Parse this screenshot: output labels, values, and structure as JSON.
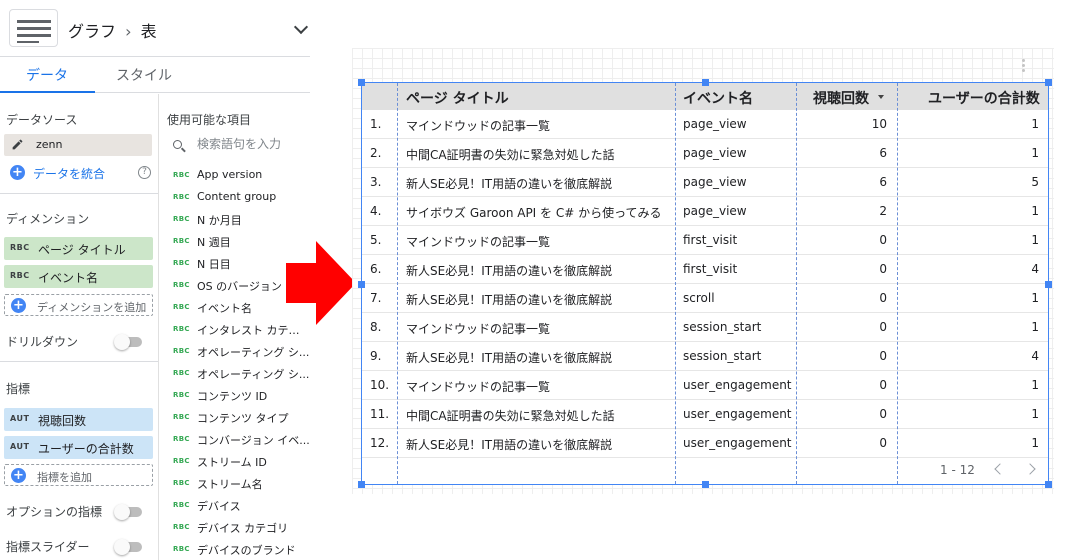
{
  "header": {
    "breadcrumb_parent": "グラフ",
    "breadcrumb_sep": "›",
    "breadcrumb_current": "表"
  },
  "tabs": {
    "data": "データ",
    "style": "スタイル"
  },
  "data_panel": {
    "data_source_title": "データソース",
    "data_source_name": "zenn",
    "blend_label": "データを統合",
    "dimension_title": "ディメンション",
    "dimensions": [
      {
        "badge": "RBC",
        "label": "ページ タイトル"
      },
      {
        "badge": "RBC",
        "label": "イベント名"
      }
    ],
    "add_dimension": "ディメンションを追加",
    "drilldown_label": "ドリルダウン",
    "metric_title": "指標",
    "metrics": [
      {
        "badge": "AUT",
        "label": "視聴回数"
      },
      {
        "badge": "AUT",
        "label": "ユーザーの合計数"
      }
    ],
    "add_metric": "指標を追加",
    "optional_metrics_label": "オプションの指標",
    "metric_slider_label": "指標スライダー"
  },
  "fields_panel": {
    "title": "使用可能な項目",
    "search_placeholder": "検索語句を入力",
    "type_badge": "RBC",
    "fields": [
      "App version",
      "Content group",
      "N か月目",
      "N 週目",
      "N 日目",
      "OS のバージョン",
      "イベント名",
      "インタレスト カテゴリ",
      "オペレーティング シ...",
      "オペレーティング シ...",
      "コンテンツ ID",
      "コンテンツ タイプ",
      "コンバージョン イベ...",
      "ストリーム ID",
      "ストリーム名",
      "デバイス",
      "デバイス カテゴリ",
      "デバイスのブランド"
    ]
  },
  "table": {
    "headers": {
      "title": "ページ タイトル",
      "event": "イベント名",
      "views": "視聴回数",
      "users": "ユーザーの合計数"
    },
    "rows": [
      {
        "idx": "1.",
        "title": "マインドウッドの記事一覧",
        "event": "page_view",
        "views": "10",
        "users": "1"
      },
      {
        "idx": "2.",
        "title": "中間CA証明書の失効に緊急対処した話",
        "event": "page_view",
        "views": "6",
        "users": "1"
      },
      {
        "idx": "3.",
        "title": "新人SE必見！IT用語の違いを徹底解説",
        "event": "page_view",
        "views": "6",
        "users": "5"
      },
      {
        "idx": "4.",
        "title": "サイボウズ Garoon API を C# から使ってみる",
        "event": "page_view",
        "views": "2",
        "users": "1"
      },
      {
        "idx": "5.",
        "title": "マインドウッドの記事一覧",
        "event": "first_visit",
        "views": "0",
        "users": "1"
      },
      {
        "idx": "6.",
        "title": "新人SE必見！IT用語の違いを徹底解説",
        "event": "first_visit",
        "views": "0",
        "users": "4"
      },
      {
        "idx": "7.",
        "title": "新人SE必見！IT用語の違いを徹底解説",
        "event": "scroll",
        "views": "0",
        "users": "1"
      },
      {
        "idx": "8.",
        "title": "マインドウッドの記事一覧",
        "event": "session_start",
        "views": "0",
        "users": "1"
      },
      {
        "idx": "9.",
        "title": "新人SE必見！IT用語の違いを徹底解説",
        "event": "session_start",
        "views": "0",
        "users": "4"
      },
      {
        "idx": "10.",
        "title": "マインドウッドの記事一覧",
        "event": "user_engagement",
        "views": "0",
        "users": "1"
      },
      {
        "idx": "11.",
        "title": "中間CA証明書の失効に緊急対処した話",
        "event": "user_engagement",
        "views": "0",
        "users": "1"
      },
      {
        "idx": "12.",
        "title": "新人SE必見！IT用語の違いを徹底解説",
        "event": "user_engagement",
        "views": "0",
        "users": "1"
      }
    ],
    "pagination": "1 - 12"
  },
  "colors": {
    "accent": "#1a73e8",
    "selection": "#4285f4",
    "dimension_chip": "#cce6c9",
    "metric_chip": "#cce4f7",
    "arrow": "#ff0000"
  }
}
